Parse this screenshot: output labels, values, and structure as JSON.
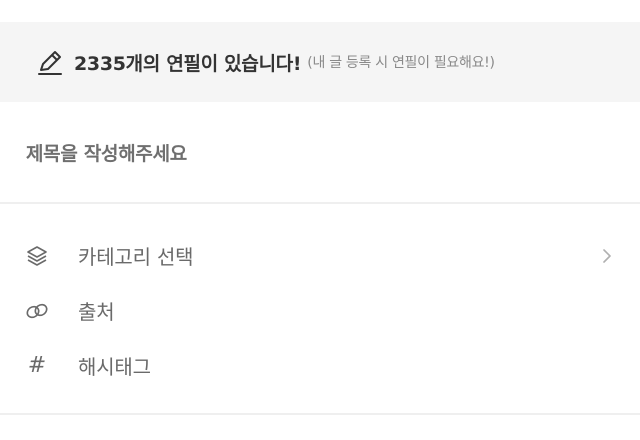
{
  "banner": {
    "main_text": "2335개의 연필이 있습니다!",
    "sub_text": "(내 글 등록 시 연필이 필요해요!)"
  },
  "title_field": {
    "placeholder": "제목을 작성해주세요"
  },
  "options": [
    {
      "label": "카테고리 선택",
      "icon": "layers-icon",
      "has_chevron": true
    },
    {
      "label": "출처",
      "icon": "link-icon",
      "has_chevron": false
    },
    {
      "label": "해시태그",
      "icon": "hash-icon",
      "has_chevron": false
    }
  ],
  "colors": {
    "banner_bg": "#f5f5f5",
    "text_dark": "#333333",
    "text_muted": "#8a8a8a",
    "icon_gray": "#6a6a6a",
    "divider": "#efefef"
  },
  "icons": {
    "hash_glyph": "#"
  }
}
